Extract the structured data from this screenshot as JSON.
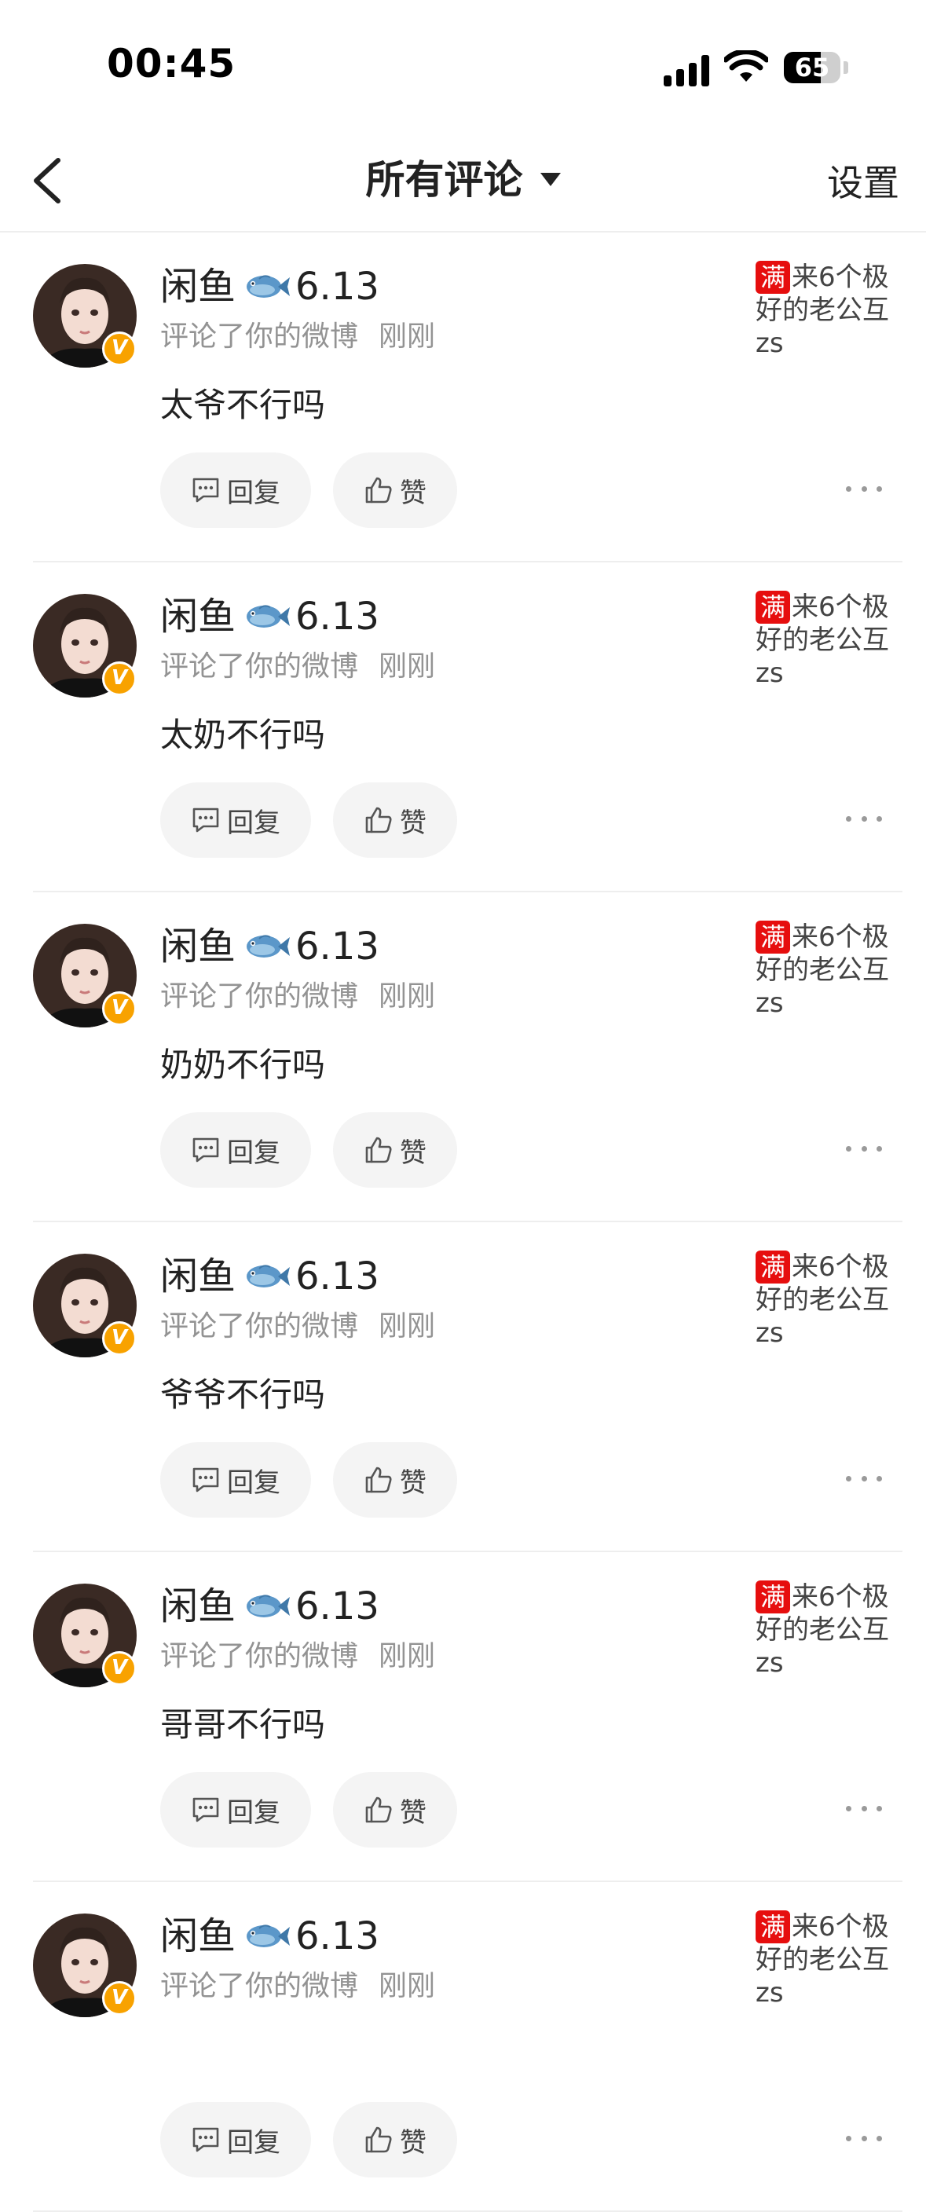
{
  "status_bar": {
    "time": "00:45",
    "battery": "65",
    "battery_level": 0.65
  },
  "nav": {
    "title": "所有评论",
    "settings_label": "设置"
  },
  "comments": [
    {
      "user_name_pre": "闲鱼",
      "user_name_post": "6.13",
      "action": "评论了你的微博",
      "time": "刚刚",
      "text": "太爷不行吗",
      "reply_label": "回复",
      "like_label": "赞",
      "source_tag": "满",
      "source_text": "来6个极好的老公互zs"
    },
    {
      "user_name_pre": "闲鱼",
      "user_name_post": "6.13",
      "action": "评论了你的微博",
      "time": "刚刚",
      "text": "太奶不行吗",
      "reply_label": "回复",
      "like_label": "赞",
      "source_tag": "满",
      "source_text": "来6个极好的老公互zs"
    },
    {
      "user_name_pre": "闲鱼",
      "user_name_post": "6.13",
      "action": "评论了你的微博",
      "time": "刚刚",
      "text": "奶奶不行吗",
      "reply_label": "回复",
      "like_label": "赞",
      "source_tag": "满",
      "source_text": "来6个极好的老公互zs"
    },
    {
      "user_name_pre": "闲鱼",
      "user_name_post": "6.13",
      "action": "评论了你的微博",
      "time": "刚刚",
      "text": "爷爷不行吗",
      "reply_label": "回复",
      "like_label": "赞",
      "source_tag": "满",
      "source_text": "来6个极好的老公互zs"
    },
    {
      "user_name_pre": "闲鱼",
      "user_name_post": "6.13",
      "action": "评论了你的微博",
      "time": "刚刚",
      "text": "哥哥不行吗",
      "reply_label": "回复",
      "like_label": "赞",
      "source_tag": "满",
      "source_text": "来6个极好的老公互zs"
    },
    {
      "user_name_pre": "闲鱼",
      "user_name_post": "6.13",
      "action": "评论了你的微博",
      "time": "刚刚",
      "text": "",
      "reply_label": "回复",
      "like_label": "赞",
      "source_tag": "满",
      "source_text": "来6个极好的老公互zs"
    }
  ],
  "badge_letter": "V",
  "icons": {
    "back": "chevron-left-icon",
    "dropdown": "caret-down-icon",
    "fish": "fish-icon",
    "reply": "comment-bubble-icon",
    "like": "thumbs-up-icon",
    "more": "more-dots-icon",
    "vip": "verified-v-icon"
  },
  "colors": {
    "accent_red": "#e60e0e",
    "badge_orange": "#f8a200",
    "meta_gray": "#939393",
    "button_bg": "#f4f4f4"
  }
}
